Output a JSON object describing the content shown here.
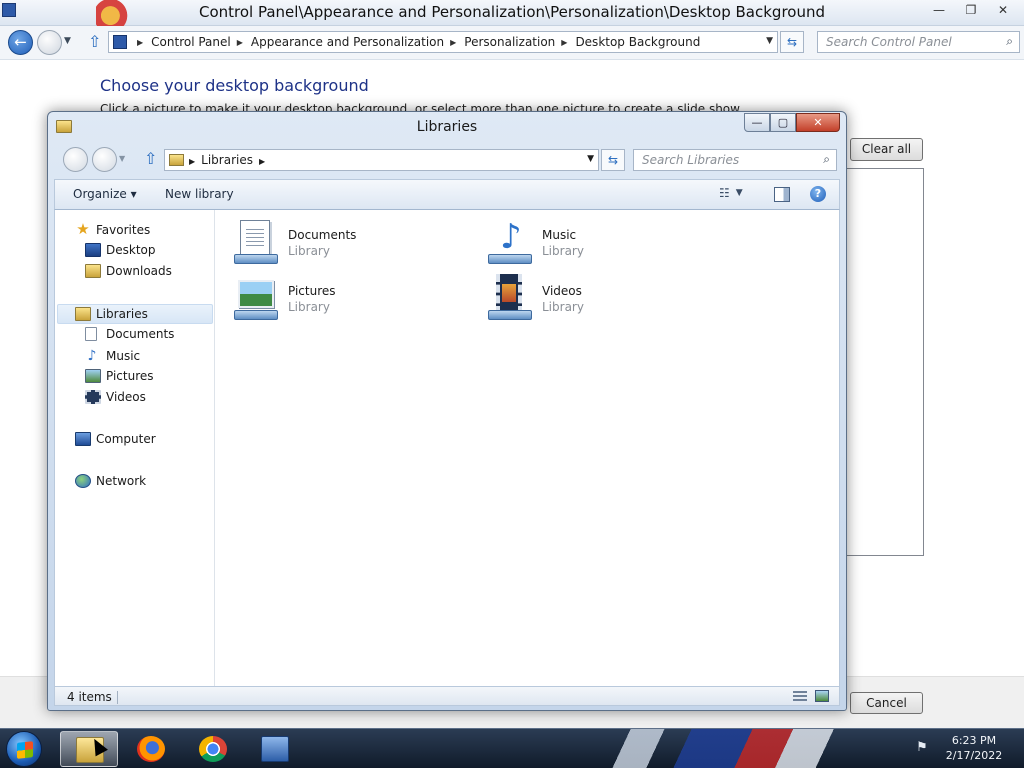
{
  "control_panel": {
    "title": "Control Panel\\Appearance and Personalization\\Personalization\\Desktop Background",
    "window_buttons": {
      "minimize": "—",
      "maximize": "❐",
      "close": "✕"
    },
    "breadcrumbs": [
      "Control Panel",
      "Appearance and Personalization",
      "Personalization",
      "Desktop Background"
    ],
    "search_placeholder": "Search Control Panel",
    "heading": "Choose your desktop background",
    "subtext": "Click a picture to make it your desktop background, or select more than one picture to create a slide show.",
    "clear_all_label": "Clear all",
    "cancel_label": "Cancel"
  },
  "libraries_window": {
    "title": "Libraries",
    "window_buttons": {
      "minimize": "—",
      "maximize": "▢",
      "close": "✕"
    },
    "address_path": "Libraries",
    "search_placeholder": "Search Libraries",
    "toolbar": {
      "organize_label": "Organize ▾",
      "new_library_label": "New library",
      "help_label": "?"
    },
    "nav": {
      "favorites": {
        "label": "Favorites",
        "items": [
          "Desktop",
          "Downloads"
        ]
      },
      "libraries": {
        "label": "Libraries",
        "items": [
          "Documents",
          "Music",
          "Pictures",
          "Videos"
        ]
      },
      "computer": "Computer",
      "network": "Network"
    },
    "tiles": [
      {
        "name": "Documents",
        "type": "Library",
        "icon": "documents-library-icon"
      },
      {
        "name": "Music",
        "type": "Library",
        "icon": "music-library-icon"
      },
      {
        "name": "Pictures",
        "type": "Library",
        "icon": "pictures-library-icon"
      },
      {
        "name": "Videos",
        "type": "Library",
        "icon": "videos-library-icon"
      }
    ],
    "status": {
      "item_count": "4 items"
    }
  },
  "taskbar": {
    "apps": [
      "windows-explorer",
      "firefox",
      "chrome",
      "control-panel"
    ],
    "active_app": "windows-explorer",
    "clock_time": "6:23 PM",
    "clock_date": "2/17/2022"
  }
}
